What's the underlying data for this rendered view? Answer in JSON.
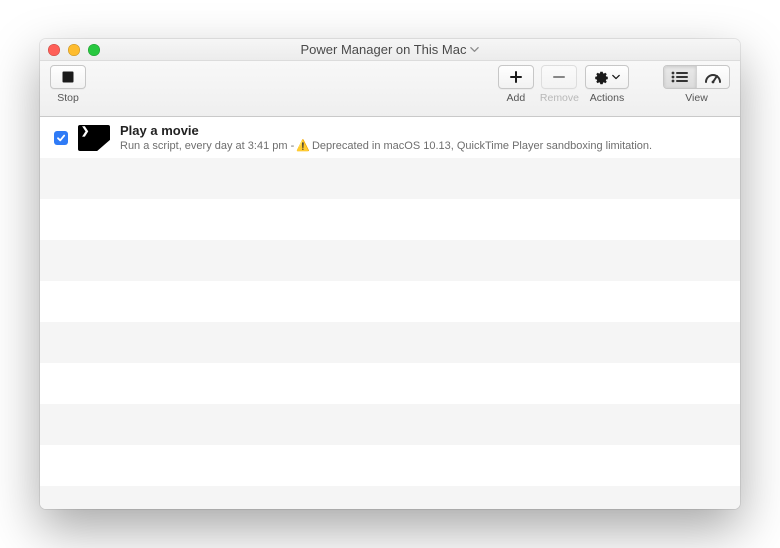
{
  "window": {
    "title": "Power Manager on This Mac"
  },
  "toolbar": {
    "stop_label": "Stop",
    "add_label": "Add",
    "remove_label": "Remove",
    "actions_label": "Actions",
    "view_label": "View"
  },
  "events": [
    {
      "enabled": true,
      "title": "Play a movie",
      "subtitle_prefix": "Run a script, every day at 3:41 pm - ",
      "warning": "Deprecated in macOS 10.13, QuickTime Player sandboxing limitation."
    }
  ],
  "icons": {
    "stop": "stop-icon",
    "plus": "plus-icon",
    "minus": "minus-icon",
    "gear": "gear-icon",
    "chevron": "chevron-down-icon",
    "list": "list-icon",
    "gauge": "gauge-icon",
    "check": "check-icon",
    "warn": "⚠️"
  }
}
